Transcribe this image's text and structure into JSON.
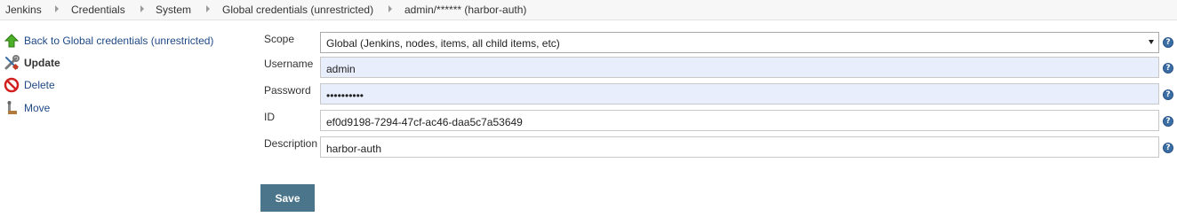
{
  "breadcrumb": {
    "items": [
      "Jenkins",
      "Credentials",
      "System",
      "Global credentials (unrestricted)",
      "admin/****** (harbor-auth)"
    ]
  },
  "sidebar": {
    "items": [
      {
        "label": "Back to Global credentials (unrestricted)",
        "icon": "up-arrow-icon"
      },
      {
        "label": "Update",
        "icon": "wrench-screwdriver-icon"
      },
      {
        "label": "Delete",
        "icon": "no-entry-icon"
      },
      {
        "label": "Move",
        "icon": "move-icon"
      }
    ]
  },
  "form": {
    "scope": {
      "label": "Scope",
      "value": "Global (Jenkins, nodes, items, all child items, etc)"
    },
    "username": {
      "label": "Username",
      "value": "admin"
    },
    "password": {
      "label": "Password",
      "value": "••••••••••"
    },
    "id": {
      "label": "ID",
      "value": "ef0d9198-7294-47cf-ac46-daa5c7a53649"
    },
    "description": {
      "label": "Description",
      "value": "harbor-auth"
    },
    "help_glyph": "?",
    "save_label": "Save"
  },
  "colors": {
    "accent": "#4b758b",
    "link": "#204a87",
    "autofill": "#e8eefc",
    "help": "#3b6ea5"
  }
}
